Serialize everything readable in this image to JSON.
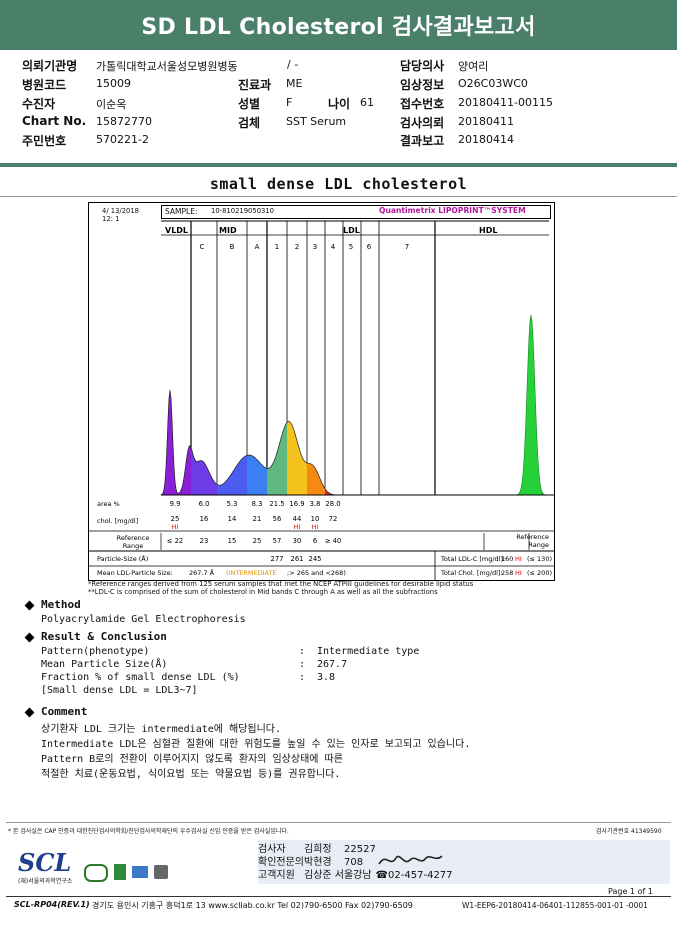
{
  "report": {
    "title": "SD LDL Cholesterol 검사결과보고서"
  },
  "patient": {
    "fields_left": [
      {
        "label": "의뢰기관명",
        "value": "가톨릭대학교서울성모병원병동"
      },
      {
        "label": "병원코드",
        "value": "15009"
      },
      {
        "label": "수진자",
        "value": "이순옥"
      },
      {
        "label": "Chart No.",
        "value": "15872770"
      },
      {
        "label": "주민번호",
        "value": "570221-2"
      }
    ],
    "ward_value": "/ -",
    "fields_mid": [
      {
        "label": "진료과",
        "value": "ME"
      },
      {
        "label": "성별",
        "value": "F"
      },
      {
        "label": "검체",
        "value": "SST Serum"
      }
    ],
    "age_label": "나이",
    "age_value": "61",
    "fields_right": [
      {
        "label": "담당의사",
        "value": "양여리"
      },
      {
        "label": "임상정보",
        "value": "O26C03WC0"
      },
      {
        "label": "접수번호",
        "value": "20180411-00115"
      },
      {
        "label": "검사의뢰",
        "value": "20180411"
      },
      {
        "label": "결과보고",
        "value": "20180414"
      }
    ]
  },
  "section_title": "small dense LDL cholesterol",
  "lipoprint": {
    "date": "4/ 13/2018",
    "run": "12: 1",
    "sample_label": "SAMPLE:",
    "sample_id": "10-810219050310",
    "system_label": "Quantimetrix LIPOPRINT™SYSTEM",
    "groups": [
      "VLDL",
      "MID",
      "LDL",
      "HDL"
    ],
    "bands": [
      "C",
      "B",
      "A",
      "1",
      "2",
      "3",
      "4",
      "5",
      "6",
      "7"
    ],
    "row_labels": {
      "area": "area %",
      "chol": "chol. [mg/dl]",
      "ref": "Reference Range",
      "size": "Particle-Size (Å)"
    },
    "area": [
      "9.9",
      "6.0",
      "5.3",
      "8.3",
      "21.5",
      "16.9",
      "3.8",
      "28.0"
    ],
    "chol": [
      "25",
      "16",
      "14",
      "21",
      "56",
      "44",
      "10",
      "72"
    ],
    "chol_hi": [
      "HI",
      "",
      "",
      "",
      "",
      "HI",
      "HI"
    ],
    "ref": [
      "≤ 22",
      "23",
      "15",
      "25",
      "57",
      "30",
      "6",
      "≥ 40"
    ],
    "particle_size": [
      "277",
      "261",
      "245"
    ],
    "total_ldl_label": "Total LDL-C [mg/dl]:",
    "total_ldl_value": "160",
    "total_ldl_flag": "HI",
    "total_ldl_ref": "(≤ 130)",
    "total_chol_label": "Total Chol. [mg/dl]:",
    "total_chol_value": "258",
    "total_chol_flag": "HI",
    "total_chol_ref": "(≤ 200)",
    "mean_size_label": "Mean LDL-Particle Size:",
    "mean_size_value": "267.7 Å",
    "mean_size_class": "(INTERMEDIATE",
    "mean_size_rest": ";> 265 and <268)",
    "footnote1": "*Reference ranges derived from 125 serum samples that met the NCEP ATPIII guidelines for desirable lipid status",
    "footnote2": "**LDL-C is comprised of the sum of cholesterol in Mid bands C through A as well as all the subfractions"
  },
  "method": {
    "heading": "Method",
    "text": "Polyacrylamide Gel Electrophoresis"
  },
  "result": {
    "heading": "Result & Conclusion",
    "rows": [
      {
        "label": "Pattern(phenotype)",
        "value": "Intermediate type"
      },
      {
        "label": "Mean Particle Size(Å)",
        "value": "267.7"
      },
      {
        "label": "Fraction % of small dense LDL (%)",
        "value": "3.8"
      }
    ],
    "note": "[Small dense LDL = LDL3~7]"
  },
  "comment": {
    "heading": "Comment",
    "lines": [
      "상기환자 LDL 크기는 intermediate에 해당됩니다.",
      "Intermediate LDL은 심혈관 질환에 대한 위험도를 높일 수 있는 인자로 보고되고 있습니다.",
      "Pattern B로의 전환이 이루어지지 않도록 환자의 임상상태에 따른",
      "적절한 치료(운동요법, 식이요법 또는 약물요법 등)를 권유합니다."
    ]
  },
  "footer": {
    "notice": "* 본 검사실은 CAP 인증과 대한진단검사의학회/진단검사의학재단의 우수검사실 신임 인증을 받은 검사실입니다.",
    "cert_no": "검사기관번호 41349590",
    "brand": "SCL",
    "brand_sub": "(재)서울의과학연구소",
    "staff": [
      {
        "role": "검사자",
        "name": "김희정",
        "id": "22527"
      },
      {
        "role": "확인전문의",
        "name": "박현경",
        "id": "708"
      },
      {
        "role": "고객지원",
        "name": "김상준 서울강남",
        "id": "☎02-457-4277"
      }
    ],
    "page": "Page 1 of 1",
    "doc_code": "SCL-RP04(REV.1)",
    "address": "경기도 용인시 기흥구 흥덕1로 13  www.scllab.co.kr   Tel 02)790-6500   Fax 02)790-6509",
    "doc_id": "W1-EEP6-20180414-06401-112855-001-01  -0001"
  }
}
